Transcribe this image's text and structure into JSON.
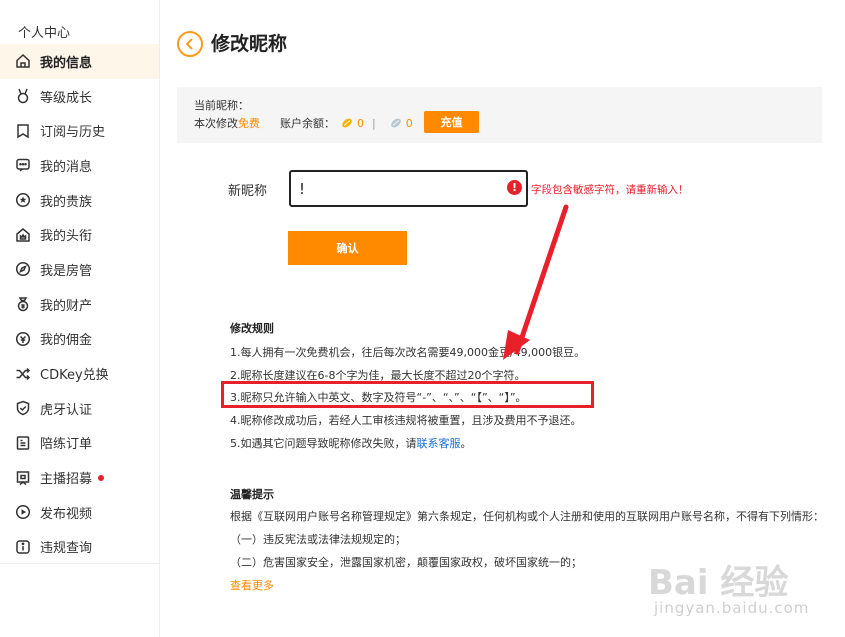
{
  "sidebar": {
    "title": "个人中心",
    "items": [
      {
        "label": "我的信息",
        "icon": "home-icon",
        "active": true
      },
      {
        "label": "等级成长",
        "icon": "medal-icon"
      },
      {
        "label": "订阅与历史",
        "icon": "bookmark-icon"
      },
      {
        "label": "我的消息",
        "icon": "message-icon"
      },
      {
        "label": "我的贵族",
        "icon": "star-circle-icon"
      },
      {
        "label": "我的头衔",
        "icon": "crown-house-icon"
      },
      {
        "label": "我是房管",
        "icon": "compass-icon"
      },
      {
        "label": "我的财产",
        "icon": "wallet-icon"
      },
      {
        "label": "我的佣金",
        "icon": "coin-icon"
      },
      {
        "label": "CDKey兑换",
        "icon": "shuffle-icon"
      },
      {
        "label": "虎牙认证",
        "icon": "shield-check-icon"
      },
      {
        "label": "陪练订单",
        "icon": "order-icon"
      },
      {
        "label": "主播招募",
        "icon": "flag-icon",
        "badge": true
      },
      {
        "label": "发布视频",
        "icon": "play-icon"
      },
      {
        "label": "违规查询",
        "icon": "info-icon"
      }
    ]
  },
  "page": {
    "title": "修改昵称"
  },
  "info": {
    "current_label": "当前昵称：",
    "modify_prefix": "本次修改",
    "modify_free": "免费",
    "balance_label": "账户余额：",
    "gold": "0",
    "silver": "0",
    "recharge": "充值"
  },
  "form": {
    "nick_label": "新昵称",
    "nick_value": "!",
    "error": "字段包含敏感字符，请重新输入！",
    "confirm": "确认"
  },
  "rules": {
    "title": "修改规则",
    "items": [
      "1.每人拥有一次免费机会，往后每次改名需要49,000金豆/49,000银豆。",
      "2.昵称长度建议在6-8个字为佳，最大长度不超过20个字符。",
      "3.昵称只允许输入中英文、数字及符号“-”、“、”、“【”、“】”。",
      "4.昵称修改成功后，若经人工审核违规将被重置，且涉及费用不予退还。"
    ],
    "item5_prefix": "5.如遇其它问题导致昵称修改失败，请",
    "item5_link": "联系客服",
    "item5_suffix": "。"
  },
  "tips": {
    "title": "温馨提示",
    "text": "根据《互联网用户账号名称管理规定》第六条规定，任何机构或个人注册和使用的互联网用户账号名称，不得有下列情形：",
    "items": [
      "（一）违反宪法或法律法规规定的；",
      "（二）危害国家安全，泄露国家机密，颠覆国家政权，破坏国家统一的；"
    ],
    "more": "查看更多"
  },
  "watermark": {
    "line1": "Bai 经验",
    "line2": "jingyan.baidu.com"
  },
  "colors": {
    "accent": "#ff8a00",
    "error": "#e8202a",
    "link": "#1a6fd6"
  }
}
